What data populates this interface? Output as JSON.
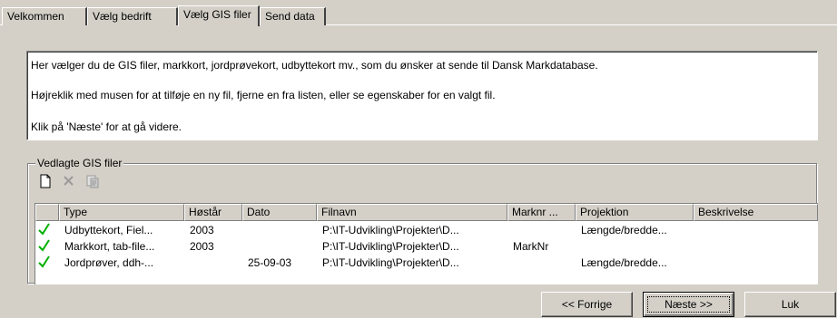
{
  "tabs": [
    {
      "label": "Velkommen"
    },
    {
      "label": "Vælg bedrift"
    },
    {
      "label": "Vælg GIS filer"
    },
    {
      "label": "Send data"
    }
  ],
  "active_tab": 2,
  "info": {
    "line1": "Her vælger du de GIS filer, markkort, jordprøvekort, udbyttekort mv., som du ønsker at sende til Dansk Markdatabase.",
    "line2": "Højreklik med musen for at tilføje en ny fil, fjerne en fra listen, eller se egenskaber for en valgt fil.",
    "line3": "Klik på 'Næste' for at gå videre."
  },
  "group": {
    "title": "Vedlagte GIS filer",
    "toolbar": [
      {
        "icon": "new-file-icon"
      },
      {
        "icon": "delete-icon"
      },
      {
        "icon": "properties-icon"
      }
    ]
  },
  "grid": {
    "columns": [
      {
        "label": "Type"
      },
      {
        "label": "Høstår"
      },
      {
        "label": "Dato"
      },
      {
        "label": "Filnavn"
      },
      {
        "label": "Marknr ..."
      },
      {
        "label": "Projektion"
      },
      {
        "label": "Beskrivelse"
      }
    ],
    "rows": [
      {
        "checked": true,
        "type": "Udbyttekort, Fiel...",
        "year": "2003",
        "date": "",
        "file": "P:\\IT-Udvikling\\Projekter\\D...",
        "marknr": "",
        "projection": "Længde/bredde...",
        "description": ""
      },
      {
        "checked": true,
        "type": "Markkort, tab-file...",
        "year": "2003",
        "date": "",
        "file": "P:\\IT-Udvikling\\Projekter\\D...",
        "marknr": "MarkNr",
        "projection": "",
        "description": ""
      },
      {
        "checked": true,
        "type": "Jordprøver, ddh-...",
        "year": "",
        "date": "25-09-03",
        "file": "P:\\IT-Udvikling\\Projekter\\D...",
        "marknr": "",
        "projection": "Længde/bredde...",
        "description": ""
      }
    ]
  },
  "buttons": {
    "back": "<< Forrige",
    "next": "Næste >>",
    "close": "Luk"
  },
  "colors": {
    "window_bg": "#d4d0c8",
    "check_green": "#00b000"
  }
}
